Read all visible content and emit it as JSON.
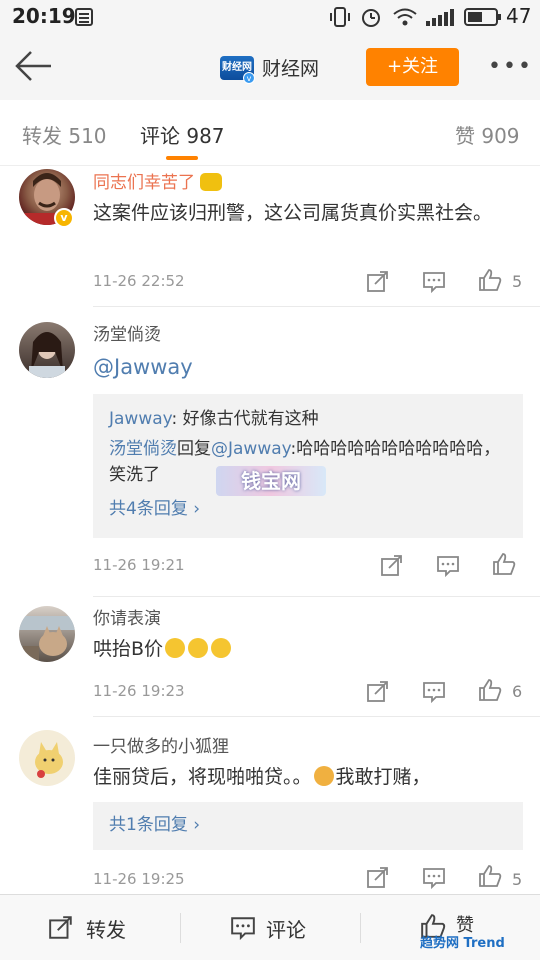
{
  "status": {
    "time": "20:19",
    "battery": "47"
  },
  "nav": {
    "title": "财经网",
    "follow_label": "+关注",
    "logo_text": "财经网",
    "more": "•••"
  },
  "tabs": [
    {
      "label": "转发 510"
    },
    {
      "label": "评论 987"
    },
    {
      "label": "赞 909"
    }
  ],
  "comments": [
    {
      "user": "同志们幸苦了",
      "text": "这案件应该归刑警，这公司属货真价实黑社会。",
      "time": "11-26 22:52",
      "likes": "5"
    },
    {
      "user": "汤堂倘烫",
      "text": "@Jawway",
      "time": "11-26 19:21",
      "likes": "",
      "quote": {
        "line1_user": "Jawway",
        "line1_text": ": 好像古代就有这种",
        "line2_user": "汤堂倘烫",
        "line2_mid": "回复",
        "line2_mention": "@Jawway",
        "line2_text": ":哈哈哈哈哈哈哈哈哈哈哈，笑洗了",
        "replies": "共4条回复 ›"
      }
    },
    {
      "user": "你请表演",
      "text": "哄抬B价",
      "time": "11-26 19:23",
      "likes": "6"
    },
    {
      "user": "一只做多的小狐狸",
      "text": "佳丽贷后，将现啪啪贷。。",
      "text2": "我敢打赌，",
      "time": "11-26 19:25",
      "likes": "5",
      "quote": {
        "replies": "共1条回复 ›"
      }
    }
  ],
  "bottom": {
    "repost": "转发",
    "comment": "评论",
    "like": "赞"
  },
  "watermark": {
    "sticker": "钱宝网",
    "brand": "趋势网 Trend"
  },
  "colors": {
    "accent": "#ff8200",
    "link": "#507daf",
    "username_highlight": "#eb7350"
  }
}
